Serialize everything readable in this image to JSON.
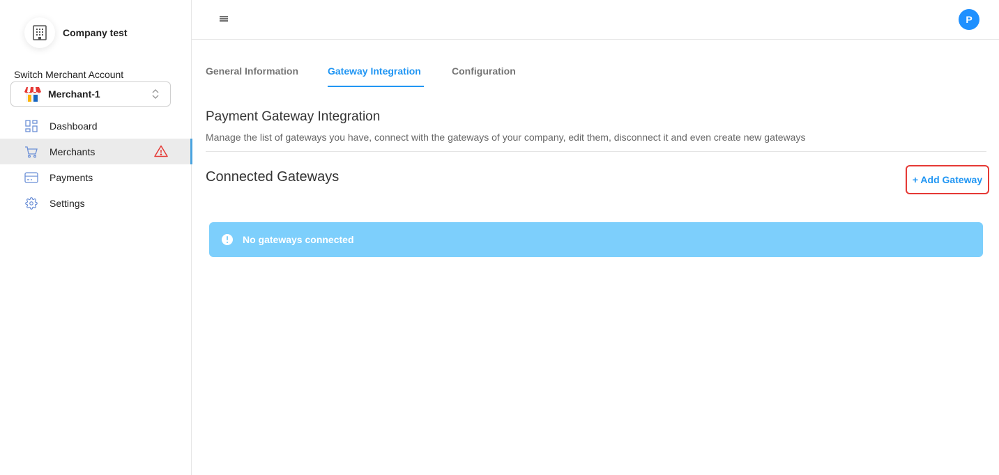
{
  "sidebar": {
    "company_name": "Company test",
    "company_icon": "building-icon",
    "switch_label": "Switch Merchant Account",
    "merchant": {
      "name": "Merchant-1",
      "icon": "store-icon"
    },
    "nav": [
      {
        "label": "Dashboard",
        "icon": "dashboard-icon",
        "active": false
      },
      {
        "label": "Merchants",
        "icon": "cart-icon",
        "active": true,
        "badge_icon": "warning-icon"
      },
      {
        "label": "Payments",
        "icon": "credit-card-icon",
        "active": false
      },
      {
        "label": "Settings",
        "icon": "gear-icon",
        "active": false
      }
    ]
  },
  "topbar": {
    "menu_icon": "hamburger-icon",
    "avatar_initial": "P"
  },
  "tabs": [
    {
      "label": "General Information",
      "active": false
    },
    {
      "label": "Gateway Integration",
      "active": true
    },
    {
      "label": "Configuration",
      "active": false
    }
  ],
  "main": {
    "title": "Payment Gateway Integration",
    "description": "Manage the list of gateways you have, connect with the gateways of your company, edit them, disconnect it and even create new gateways",
    "connected_title": "Connected Gateways",
    "add_button": "+ Add Gateway",
    "alert_text": "No gateways connected",
    "alert_icon": "info-icon"
  },
  "colors": {
    "accent": "#2196f3",
    "alert_bg": "#7dcffc",
    "warning": "#e53935",
    "avatar": "#1e90ff"
  }
}
